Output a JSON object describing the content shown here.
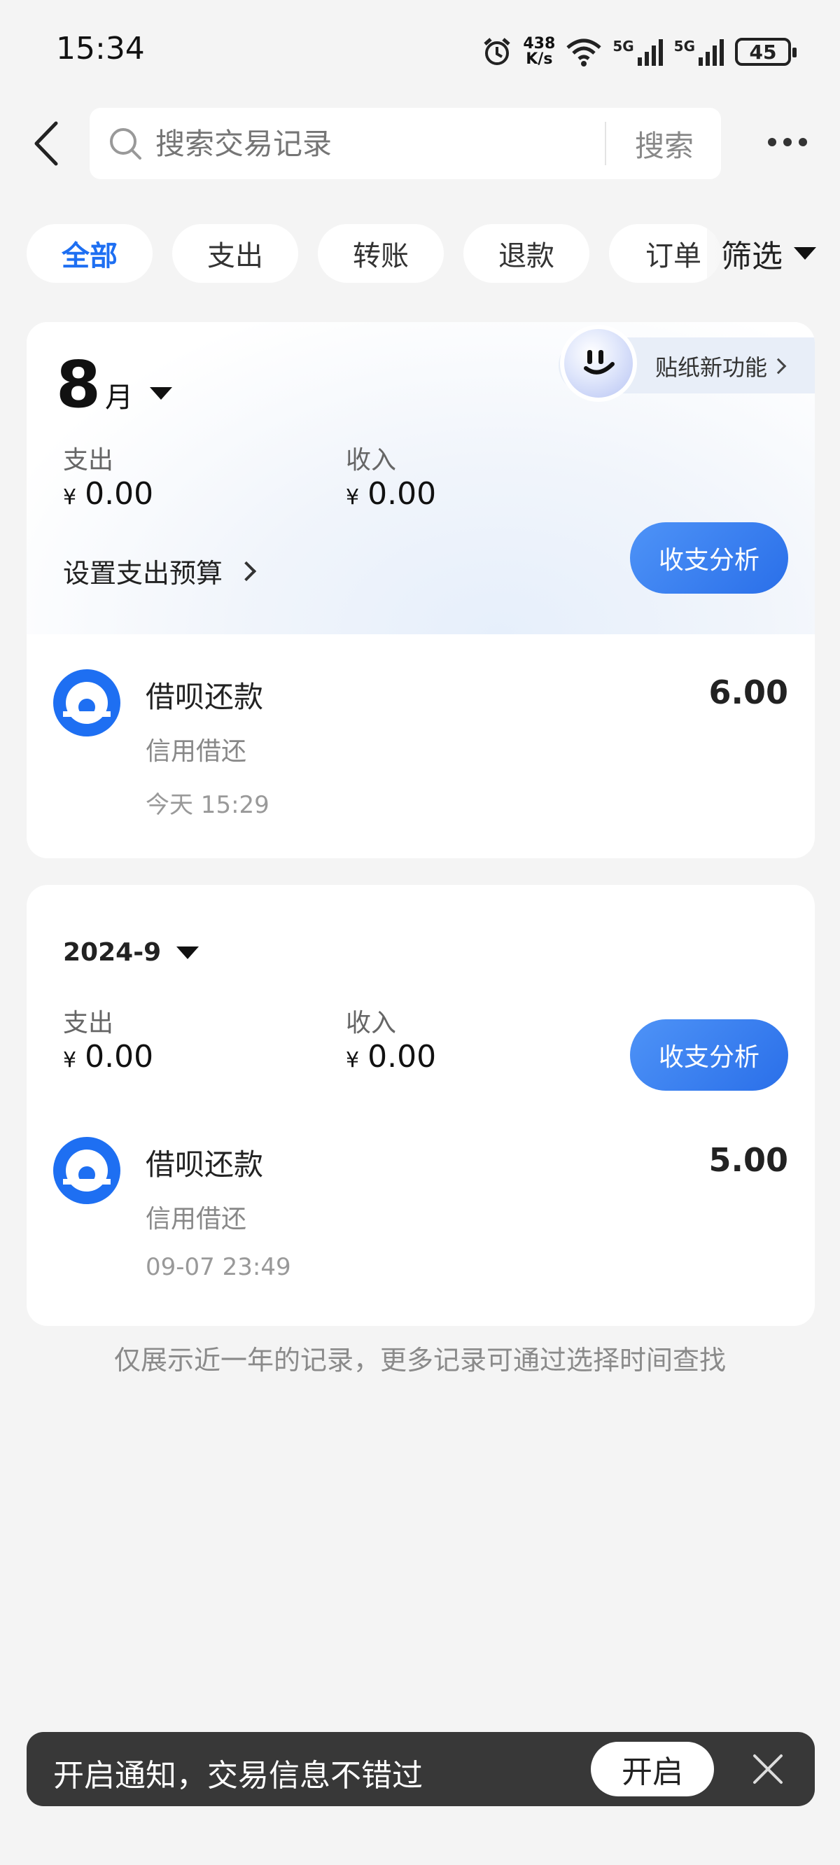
{
  "status_bar": {
    "time": "15:34",
    "net_speed_value": "438",
    "net_speed_unit": "K/s",
    "signal1_label": "5G",
    "signal2_label": "5G",
    "battery": "45"
  },
  "header": {
    "search_placeholder": "搜索交易记录",
    "search_button": "搜索"
  },
  "tabs": [
    {
      "label": "全部",
      "active": true
    },
    {
      "label": "支出",
      "active": false
    },
    {
      "label": "转账",
      "active": false
    },
    {
      "label": "退款",
      "active": false
    },
    {
      "label": "订单",
      "active": false
    }
  ],
  "filter_label": "筛选",
  "month_card": {
    "month_number": "8",
    "month_unit": "月",
    "sticker_text": "贴纸新功能",
    "expense_label": "支出",
    "expense_currency": "¥",
    "expense_value": "0.00",
    "income_label": "收入",
    "income_currency": "¥",
    "income_value": "0.00",
    "budget_link": "设置支出预算",
    "analysis_button": "收支分析",
    "transaction": {
      "title": "借呗还款",
      "category": "信用借还",
      "time": "今天 15:29",
      "amount": "6.00"
    }
  },
  "year_card": {
    "period": "2024-9",
    "expense_label": "支出",
    "expense_currency": "¥",
    "expense_value": "0.00",
    "income_label": "收入",
    "income_currency": "¥",
    "income_value": "0.00",
    "analysis_button": "收支分析",
    "transaction": {
      "title": "借呗还款",
      "category": "信用借还",
      "time": "09-07 23:49",
      "amount": "5.00"
    }
  },
  "footnote": "仅展示近一年的记录，更多记录可通过选择时间查找",
  "notification": {
    "text": "开启通知，交易信息不错过",
    "button": "开启"
  },
  "colors": {
    "accent": "#1e6ff2",
    "background": "#f4f4f4",
    "banner": "#383838"
  }
}
